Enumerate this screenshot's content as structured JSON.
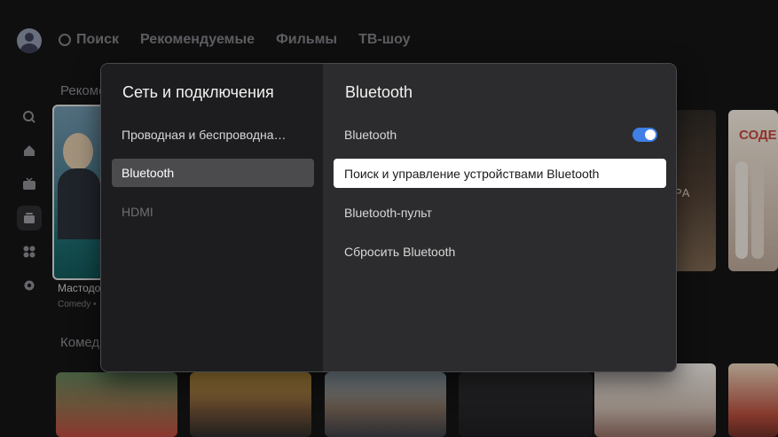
{
  "topnav": {
    "search": "Поиск",
    "recommended": "Рекомендуемые",
    "movies": "Фильмы",
    "tvshows": "ТВ-шоу"
  },
  "rows": {
    "row1_title": "Рекоменд",
    "row2_title": "Комед"
  },
  "featured": {
    "title": "Мастодо",
    "genre": "Comedy •"
  },
  "posters": {
    "poster_b_text": "СОДЕ",
    "poster_a_text": "РА"
  },
  "modal": {
    "left_title": "Сеть и подключения",
    "left_items": [
      {
        "label": "Проводная и беспроводна…",
        "state": "normal"
      },
      {
        "label": "Bluetooth",
        "state": "active"
      },
      {
        "label": "HDMI",
        "state": "disabled"
      }
    ],
    "right_title": "Bluetooth",
    "right_items": [
      {
        "label": "Bluetooth",
        "toggle": true
      },
      {
        "label": "Поиск и управление устройствами Bluetooth",
        "state": "focused"
      },
      {
        "label": "Bluetooth-пульт"
      },
      {
        "label": "Сбросить Bluetooth"
      }
    ]
  },
  "colors": {
    "toggle_on": "#3f7fe6",
    "modal_left": "#1d1d1f",
    "modal_right": "#2c2c2e"
  }
}
